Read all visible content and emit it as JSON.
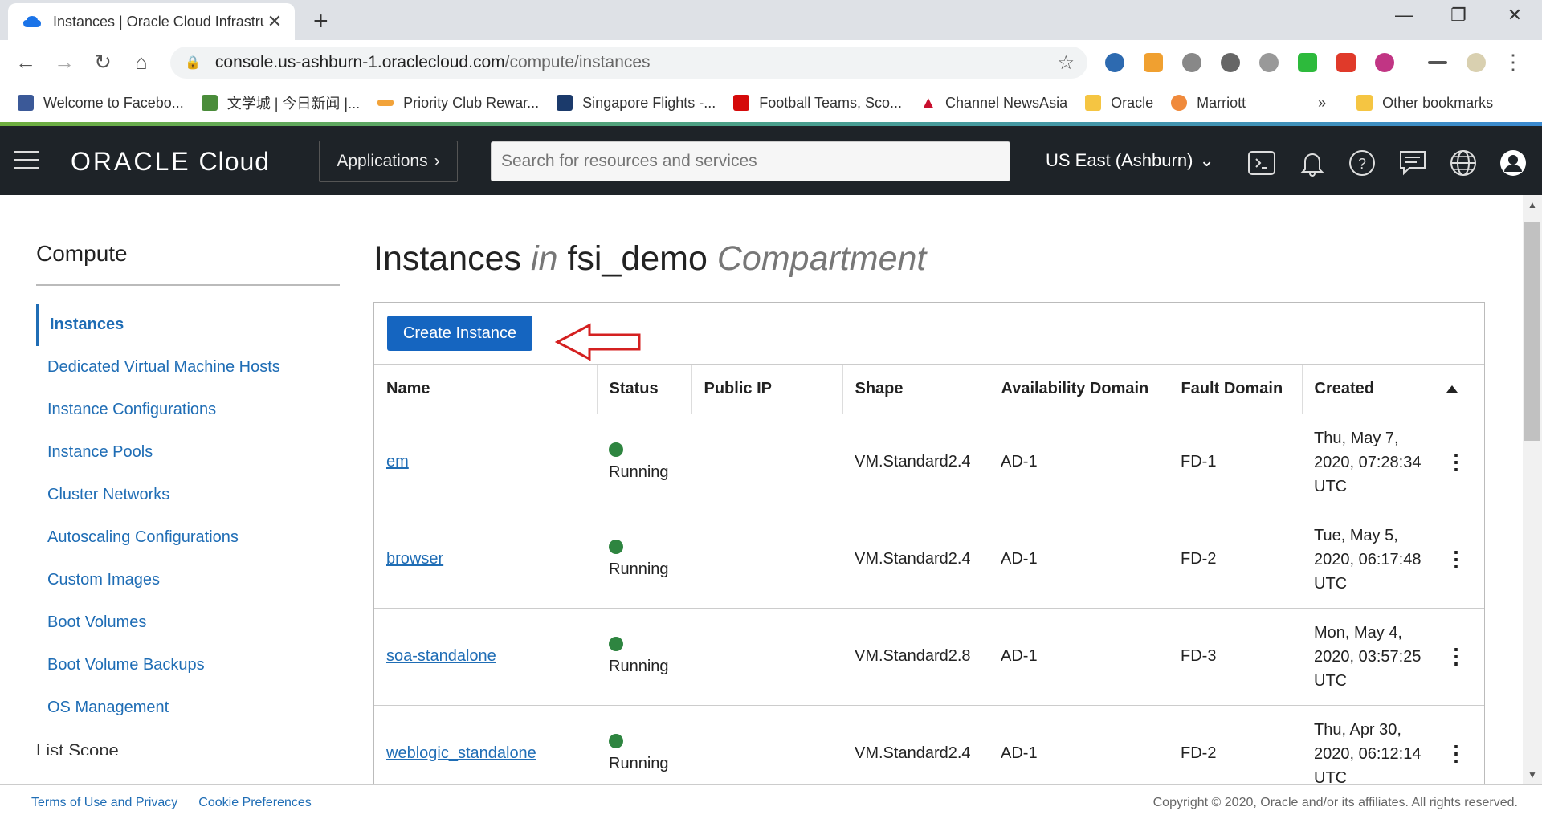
{
  "browser": {
    "tab_title": "Instances | Oracle Cloud Infrastru",
    "url_host": "console.us-ashburn-1.oraclecloud.com",
    "url_path": "/compute/instances",
    "bookmarks": [
      {
        "label": "Welcome to Facebo...",
        "color": "#3b5998"
      },
      {
        "label": "文学城 | 今日新闻 |...",
        "color": "#4a8c3a"
      },
      {
        "label": "Priority Club Rewar...",
        "color": "#f2a33a"
      },
      {
        "label": "Singapore Flights -...",
        "color": "#1b3a6b"
      },
      {
        "label": "Football Teams, Sco...",
        "color": "#d50a0a"
      },
      {
        "label": "Channel NewsAsia",
        "color": "#c8102e"
      },
      {
        "label": "Oracle",
        "color": "#f5c542"
      },
      {
        "label": "Marriott",
        "color": "#f08a3c"
      }
    ],
    "more_bookmarks": "»",
    "other_bookmarks": "Other bookmarks"
  },
  "header": {
    "logo_brand": "ORACLE",
    "logo_product": "Cloud",
    "applications_label": "Applications",
    "search_placeholder": "Search for resources and services",
    "region": "US East (Ashburn)"
  },
  "sidebar": {
    "title": "Compute",
    "items": [
      {
        "label": "Instances",
        "active": true
      },
      {
        "label": "Dedicated Virtual Machine Hosts"
      },
      {
        "label": "Instance Configurations"
      },
      {
        "label": "Instance Pools"
      },
      {
        "label": "Cluster Networks"
      },
      {
        "label": "Autoscaling Configurations"
      },
      {
        "label": "Custom Images"
      },
      {
        "label": "Boot Volumes"
      },
      {
        "label": "Boot Volume Backups"
      },
      {
        "label": "OS Management"
      }
    ],
    "partial_item": "List Scope"
  },
  "main": {
    "title_word": "Instances",
    "title_in": "in",
    "compartment": "fsi_demo",
    "compartment_word": "Compartment",
    "create_label": "Create Instance",
    "columns": [
      "Name",
      "Status",
      "Public IP",
      "Shape",
      "Availability Domain",
      "Fault Domain",
      "Created"
    ],
    "rows": [
      {
        "name": "em",
        "status": "Running",
        "public_ip": "",
        "shape": "VM.Standard2.4",
        "ad": "AD-1",
        "fd": "FD-1",
        "created_1": "Thu, May 7,",
        "created_2": "2020, 07:28:34",
        "created_3": "UTC"
      },
      {
        "name": "browser",
        "status": "Running",
        "public_ip": "",
        "shape": "VM.Standard2.4",
        "ad": "AD-1",
        "fd": "FD-2",
        "created_1": "Tue, May 5,",
        "created_2": "2020, 06:17:48",
        "created_3": "UTC"
      },
      {
        "name": "soa-standalone",
        "status": "Running",
        "public_ip": "",
        "shape": "VM.Standard2.8",
        "ad": "AD-1",
        "fd": "FD-3",
        "created_1": "Mon, May 4,",
        "created_2": "2020, 03:57:25",
        "created_3": "UTC"
      },
      {
        "name": "weblogic_standalone",
        "status": "Running",
        "public_ip": "",
        "shape": "VM.Standard2.4",
        "ad": "AD-1",
        "fd": "FD-2",
        "created_1": "Thu, Apr 30,",
        "created_2": "2020, 06:12:14",
        "created_3": "UTC"
      }
    ]
  },
  "footer": {
    "terms": "Terms of Use and Privacy",
    "cookies": "Cookie Preferences",
    "copyright": "Copyright © 2020, Oracle and/or its affiliates. All rights reserved."
  },
  "colors": {
    "accent": "#1565c0",
    "link": "#1f6db5",
    "running": "#2e8540",
    "header_bg": "#1e2328"
  }
}
